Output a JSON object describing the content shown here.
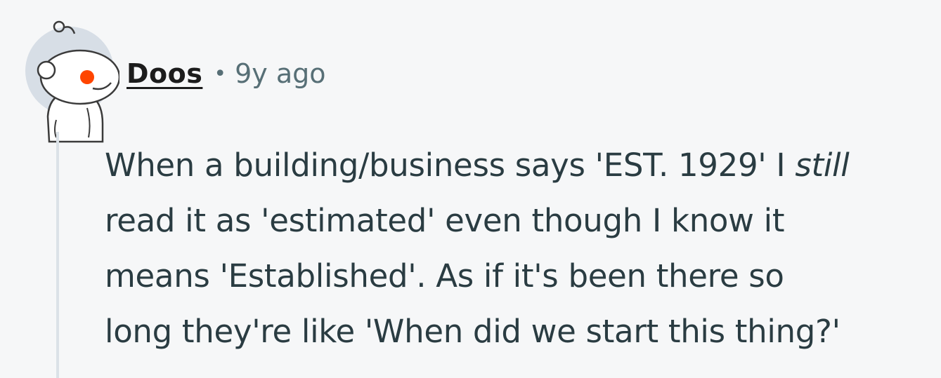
{
  "comment": {
    "username": "Doos",
    "separator": "•",
    "timestamp": "9y ago",
    "body_lines": [
      {
        "before": "When a building/business says 'EST. 1929' I ",
        "emphasis": "still",
        "after": ""
      },
      {
        "before": "read it as 'estimated' even though I know it",
        "emphasis": "",
        "after": ""
      },
      {
        "before": "means 'Established'. As if it's been there so",
        "emphasis": "",
        "after": ""
      },
      {
        "before": "long they're like 'When did we start this thing?'",
        "emphasis": "",
        "after": ""
      }
    ]
  },
  "colors": {
    "background": "#f6f7f8",
    "username": "#1c1c1c",
    "meta": "#576f76",
    "body_text": "#2a3c42",
    "thread_line": "#dbe2e8",
    "avatar_bg": "#d7dee6",
    "avatar_eye": "#ff4500"
  },
  "avatar": {
    "icon": "snoo-avatar-icon"
  }
}
